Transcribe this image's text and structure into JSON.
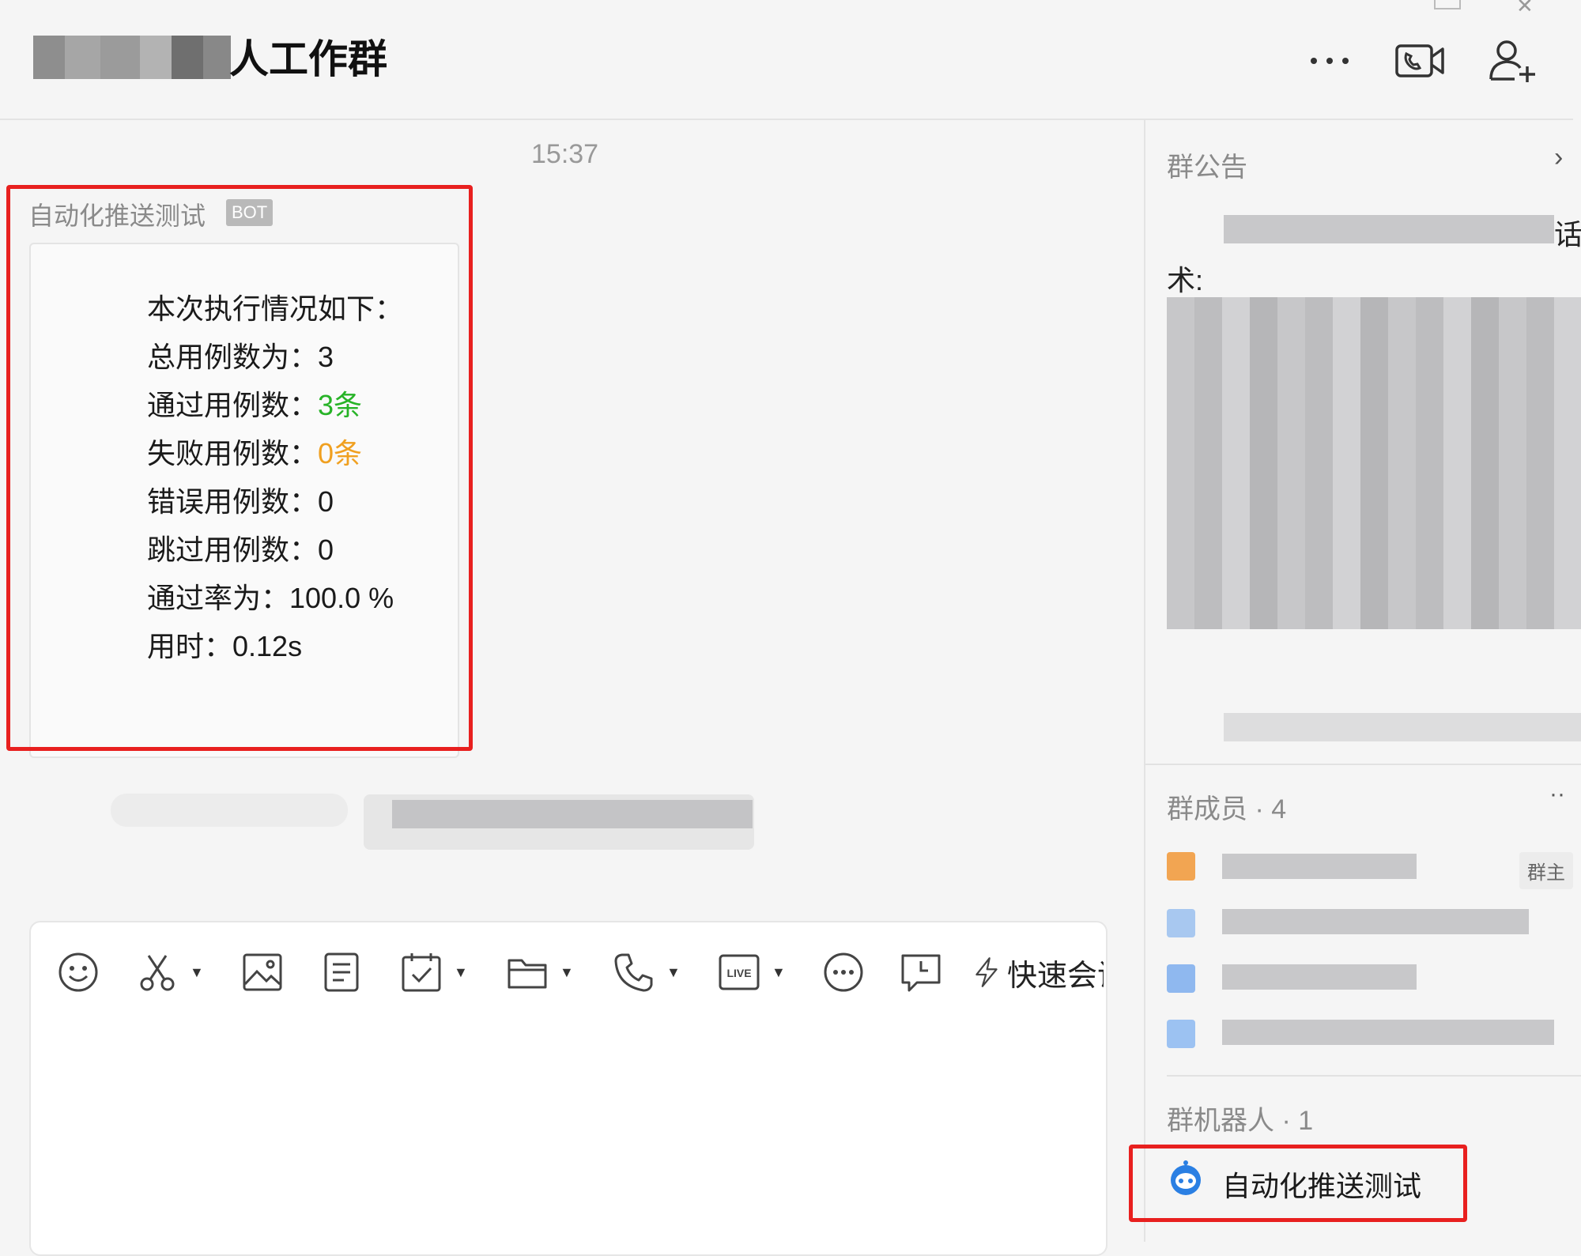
{
  "header": {
    "group_name": "人工作群",
    "icons": [
      "more-icon",
      "video-call-icon",
      "add-member-icon"
    ]
  },
  "chat": {
    "timestamp": "15:37",
    "sender": "自动化推送测试",
    "bot_badge": "BOT",
    "report": {
      "line1": "本次执行情况如下：",
      "total_label": "总用例数为：",
      "total_value": "3",
      "passed_label": "通过用例数：",
      "passed_value": "3条",
      "failed_label": "失败用例数：",
      "failed_value": "0条",
      "error_label": "错误用例数：",
      "error_value": "0",
      "skipped_label": "跳过用例数：",
      "skipped_value": "0",
      "pass_rate_label": "通过率为：",
      "pass_rate_value": "100.0 %",
      "time_label": "用时：",
      "time_value": "0.12s"
    },
    "colors": {
      "pass": "#27b327",
      "fail": "#f0a020",
      "highlight": "#e8201f"
    }
  },
  "toolbar": {
    "icons": [
      "emoji-icon",
      "screenshot-icon",
      "image-icon",
      "doc-icon",
      "todo-icon",
      "folder-icon",
      "phone-icon",
      "live-icon",
      "more-circle-icon",
      "schedule-icon",
      "lightning-icon"
    ],
    "quick_meeting": "快速会议"
  },
  "panel": {
    "announcement_title": "群公告",
    "announcement_fragment_1": "话",
    "announcement_fragment_2": "术:",
    "members_title": "群成员 · 4",
    "owner_badge": "群主",
    "robots_title": "群机器人 · 1",
    "robot_name": "自动化推送测试"
  }
}
